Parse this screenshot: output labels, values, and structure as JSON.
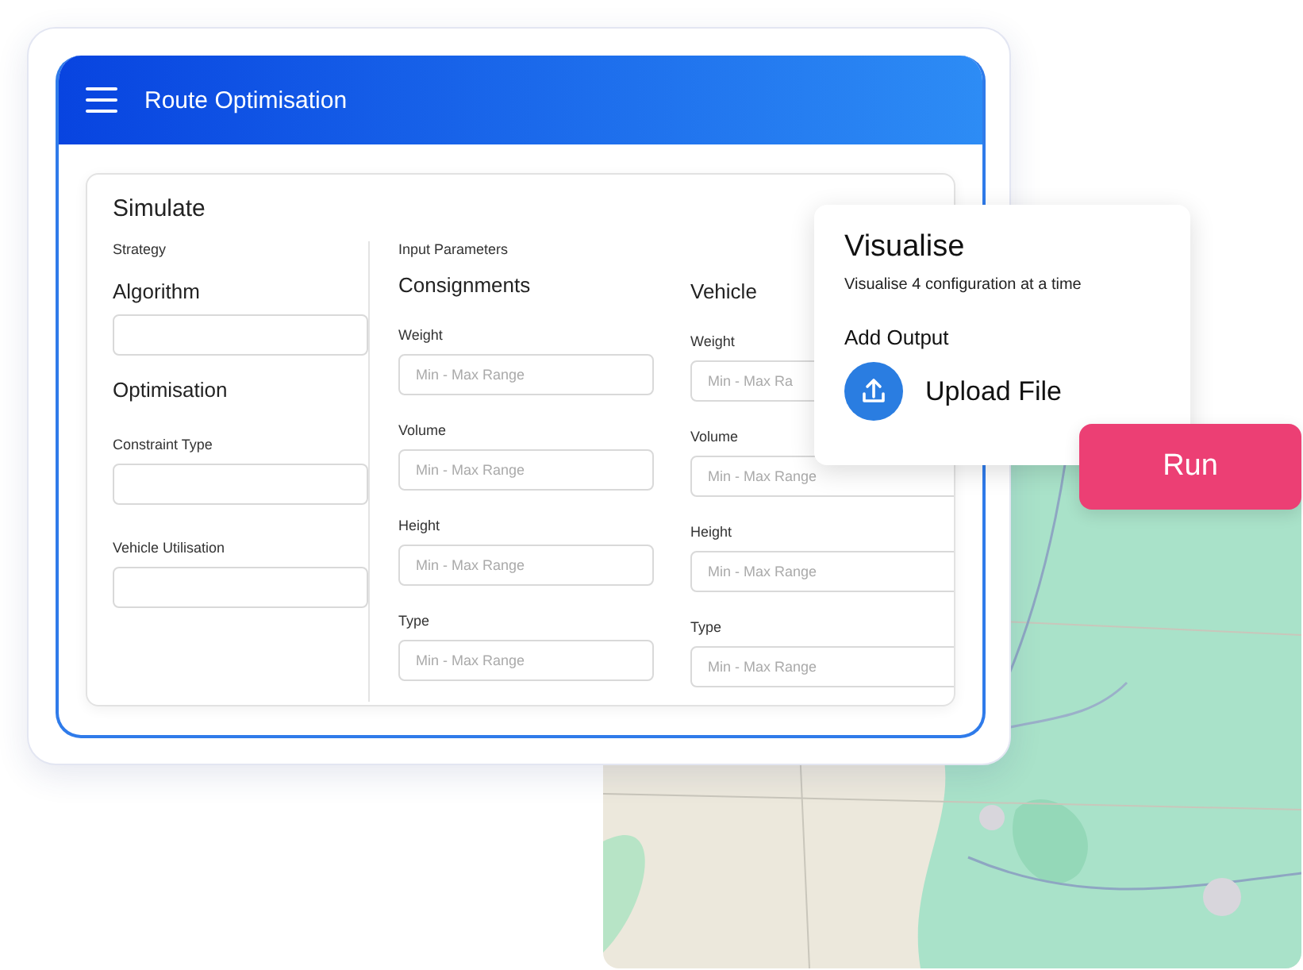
{
  "app": {
    "title": "Route Optimisation"
  },
  "simulate": {
    "title": "Simulate",
    "strategy": {
      "heading": "Strategy",
      "items": [
        {
          "kind": "title",
          "text": "Algorithm"
        },
        {
          "kind": "field"
        },
        {
          "kind": "title",
          "text": "Optimisation"
        },
        {
          "kind": "label",
          "text": "Constraint Type"
        },
        {
          "kind": "field"
        },
        {
          "kind": "label",
          "text": "Vehicle Utilisation"
        },
        {
          "kind": "field"
        }
      ]
    },
    "parameters": {
      "heading": "Input Parameters",
      "columns": [
        {
          "title": "Consignments",
          "fields": [
            {
              "label": "Weight",
              "placeholder": "Min - Max Range"
            },
            {
              "label": "Volume",
              "placeholder": "Min - Max Range"
            },
            {
              "label": "Height",
              "placeholder": "Min - Max Range"
            },
            {
              "label": "Type",
              "placeholder": "Min - Max Range"
            }
          ]
        },
        {
          "title": "Vehicle",
          "fields": [
            {
              "label": "Weight",
              "placeholder": "Min - Max Ra"
            },
            {
              "label": "Volume",
              "placeholder": "Min - Max Range"
            },
            {
              "label": "Height",
              "placeholder": "Min - Max Range"
            },
            {
              "label": "Type",
              "placeholder": "Min - Max Range"
            }
          ]
        }
      ]
    }
  },
  "visualise": {
    "title": "Visualise",
    "subtitle": "Visualise 4 configuration at a time",
    "section": "Add Output",
    "action": "Upload File"
  },
  "run_button": "Run"
}
